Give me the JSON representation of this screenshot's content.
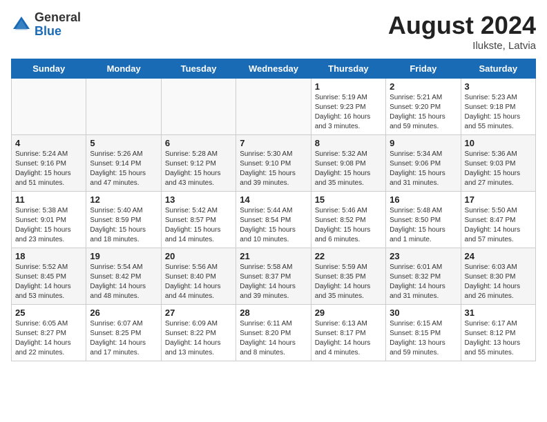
{
  "header": {
    "logo_general": "General",
    "logo_blue": "Blue",
    "month_year": "August 2024",
    "location": "Ilukste, Latvia"
  },
  "days_of_week": [
    "Sunday",
    "Monday",
    "Tuesday",
    "Wednesday",
    "Thursday",
    "Friday",
    "Saturday"
  ],
  "weeks": [
    [
      {
        "day": "",
        "info": ""
      },
      {
        "day": "",
        "info": ""
      },
      {
        "day": "",
        "info": ""
      },
      {
        "day": "",
        "info": ""
      },
      {
        "day": "1",
        "info": "Sunrise: 5:19 AM\nSunset: 9:23 PM\nDaylight: 16 hours\nand 3 minutes."
      },
      {
        "day": "2",
        "info": "Sunrise: 5:21 AM\nSunset: 9:20 PM\nDaylight: 15 hours\nand 59 minutes."
      },
      {
        "day": "3",
        "info": "Sunrise: 5:23 AM\nSunset: 9:18 PM\nDaylight: 15 hours\nand 55 minutes."
      }
    ],
    [
      {
        "day": "4",
        "info": "Sunrise: 5:24 AM\nSunset: 9:16 PM\nDaylight: 15 hours\nand 51 minutes."
      },
      {
        "day": "5",
        "info": "Sunrise: 5:26 AM\nSunset: 9:14 PM\nDaylight: 15 hours\nand 47 minutes."
      },
      {
        "day": "6",
        "info": "Sunrise: 5:28 AM\nSunset: 9:12 PM\nDaylight: 15 hours\nand 43 minutes."
      },
      {
        "day": "7",
        "info": "Sunrise: 5:30 AM\nSunset: 9:10 PM\nDaylight: 15 hours\nand 39 minutes."
      },
      {
        "day": "8",
        "info": "Sunrise: 5:32 AM\nSunset: 9:08 PM\nDaylight: 15 hours\nand 35 minutes."
      },
      {
        "day": "9",
        "info": "Sunrise: 5:34 AM\nSunset: 9:06 PM\nDaylight: 15 hours\nand 31 minutes."
      },
      {
        "day": "10",
        "info": "Sunrise: 5:36 AM\nSunset: 9:03 PM\nDaylight: 15 hours\nand 27 minutes."
      }
    ],
    [
      {
        "day": "11",
        "info": "Sunrise: 5:38 AM\nSunset: 9:01 PM\nDaylight: 15 hours\nand 23 minutes."
      },
      {
        "day": "12",
        "info": "Sunrise: 5:40 AM\nSunset: 8:59 PM\nDaylight: 15 hours\nand 18 minutes."
      },
      {
        "day": "13",
        "info": "Sunrise: 5:42 AM\nSunset: 8:57 PM\nDaylight: 15 hours\nand 14 minutes."
      },
      {
        "day": "14",
        "info": "Sunrise: 5:44 AM\nSunset: 8:54 PM\nDaylight: 15 hours\nand 10 minutes."
      },
      {
        "day": "15",
        "info": "Sunrise: 5:46 AM\nSunset: 8:52 PM\nDaylight: 15 hours\nand 6 minutes."
      },
      {
        "day": "16",
        "info": "Sunrise: 5:48 AM\nSunset: 8:50 PM\nDaylight: 15 hours\nand 1 minute."
      },
      {
        "day": "17",
        "info": "Sunrise: 5:50 AM\nSunset: 8:47 PM\nDaylight: 14 hours\nand 57 minutes."
      }
    ],
    [
      {
        "day": "18",
        "info": "Sunrise: 5:52 AM\nSunset: 8:45 PM\nDaylight: 14 hours\nand 53 minutes."
      },
      {
        "day": "19",
        "info": "Sunrise: 5:54 AM\nSunset: 8:42 PM\nDaylight: 14 hours\nand 48 minutes."
      },
      {
        "day": "20",
        "info": "Sunrise: 5:56 AM\nSunset: 8:40 PM\nDaylight: 14 hours\nand 44 minutes."
      },
      {
        "day": "21",
        "info": "Sunrise: 5:58 AM\nSunset: 8:37 PM\nDaylight: 14 hours\nand 39 minutes."
      },
      {
        "day": "22",
        "info": "Sunrise: 5:59 AM\nSunset: 8:35 PM\nDaylight: 14 hours\nand 35 minutes."
      },
      {
        "day": "23",
        "info": "Sunrise: 6:01 AM\nSunset: 8:32 PM\nDaylight: 14 hours\nand 31 minutes."
      },
      {
        "day": "24",
        "info": "Sunrise: 6:03 AM\nSunset: 8:30 PM\nDaylight: 14 hours\nand 26 minutes."
      }
    ],
    [
      {
        "day": "25",
        "info": "Sunrise: 6:05 AM\nSunset: 8:27 PM\nDaylight: 14 hours\nand 22 minutes."
      },
      {
        "day": "26",
        "info": "Sunrise: 6:07 AM\nSunset: 8:25 PM\nDaylight: 14 hours\nand 17 minutes."
      },
      {
        "day": "27",
        "info": "Sunrise: 6:09 AM\nSunset: 8:22 PM\nDaylight: 14 hours\nand 13 minutes."
      },
      {
        "day": "28",
        "info": "Sunrise: 6:11 AM\nSunset: 8:20 PM\nDaylight: 14 hours\nand 8 minutes."
      },
      {
        "day": "29",
        "info": "Sunrise: 6:13 AM\nSunset: 8:17 PM\nDaylight: 14 hours\nand 4 minutes."
      },
      {
        "day": "30",
        "info": "Sunrise: 6:15 AM\nSunset: 8:15 PM\nDaylight: 13 hours\nand 59 minutes."
      },
      {
        "day": "31",
        "info": "Sunrise: 6:17 AM\nSunset: 8:12 PM\nDaylight: 13 hours\nand 55 minutes."
      }
    ]
  ]
}
